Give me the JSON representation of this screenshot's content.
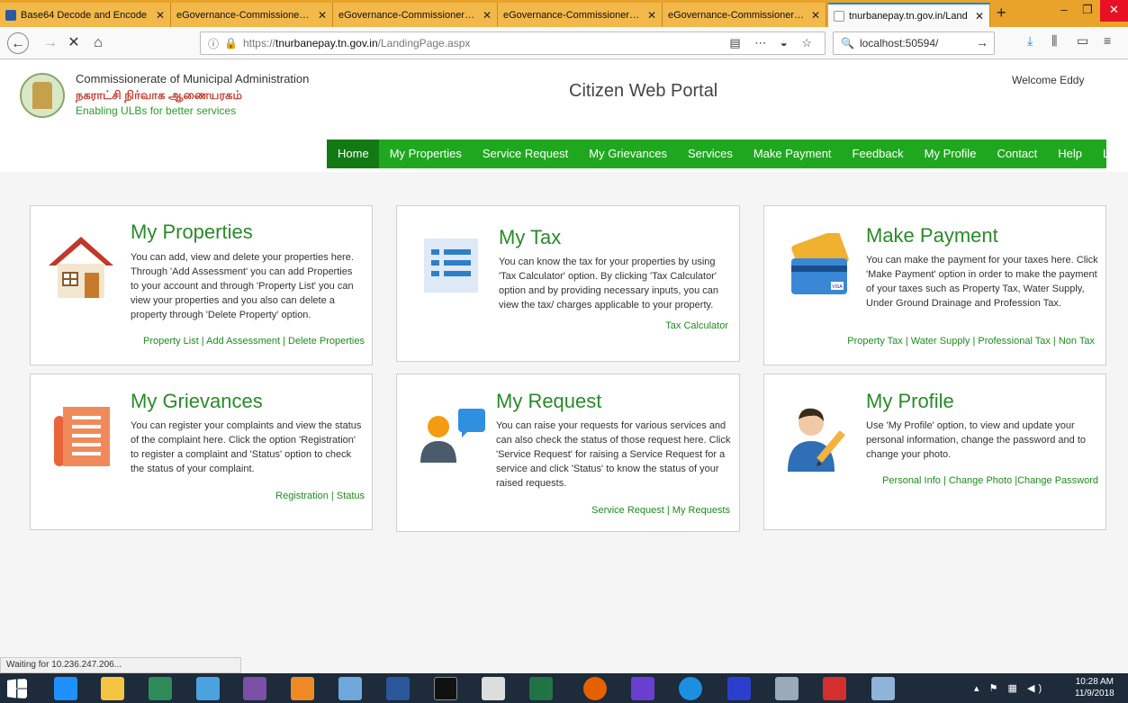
{
  "browser": {
    "tabs": [
      {
        "label": "Base64 Decode and Encode",
        "active": false
      },
      {
        "label": "eGovernance-Commissionerate",
        "active": false
      },
      {
        "label": "eGovernance-Commissionerate",
        "active": false
      },
      {
        "label": "eGovernance-Commissionerate",
        "active": false
      },
      {
        "label": "eGovernance-Commissionerate",
        "active": false
      },
      {
        "label": "tnurbanepay.tn.gov.in/Land",
        "active": true
      }
    ],
    "url_prefix": "https://",
    "url_host": "tnurbanepay.tn.gov.in",
    "url_path": "/LandingPage.aspx",
    "search_value": "localhost:50594/",
    "status_text": "Waiting for 10.236.247.206..."
  },
  "header": {
    "org_line1": "Commissionerate of Municipal Administration",
    "org_line2": "நகராட்சி நிர்வாக ஆணையரகம்",
    "org_line3": "Enabling ULBs for better services",
    "portal_title": "Citizen Web Portal",
    "welcome": "Welcome Eddy"
  },
  "menu": {
    "items": [
      "Home",
      "My Properties",
      "Service Request",
      "My Grievances",
      "Services",
      "Make Payment",
      "Feedback",
      "My Profile",
      "Contact",
      "Help",
      "Logout"
    ],
    "active_index": 0
  },
  "cards": {
    "properties": {
      "title": "My Properties",
      "text": "You can add, view and delete your properties here. Through 'Add Assessment' you can add Properties to your account and through 'Property List' you can view your properties and you also can delete a property through 'Delete Property' option.",
      "links": "Property List | Add Assessment | Delete Properties"
    },
    "tax": {
      "title": "My Tax",
      "text": "You can know the tax for your properties by using 'Tax Calculator' option. By clicking 'Tax Calculator' option and by providing necessary inputs, you can view the tax/ charges applicable to your property.",
      "links": "Tax Calculator"
    },
    "payment": {
      "title": "Make Payment",
      "text": "You can make the payment for your taxes here. Click 'Make Payment' option in order to make the payment of your taxes such as Property Tax, Water Supply, Under Ground Drainage and Profession Tax.",
      "links": "Property Tax | Water Supply | Professional Tax | Non Tax",
      "card_logo": "VISA"
    },
    "grievances": {
      "title": "My Grievances",
      "text": "You can register your complaints and view the status of the complaint here. Click the option 'Registration' to register a complaint and 'Status' option to check the status of your complaint.",
      "links": "Registration | Status"
    },
    "request": {
      "title": "My Request",
      "text": "You can raise your requests for various services and can also check the status of those request here. Click 'Service Request' for raising a Service Request for a service and click 'Status' to know the status of your raised requests.",
      "links": "Service Request | My Requests"
    },
    "profile": {
      "title": "My Profile",
      "text": "Use 'My Profile' option, to view and update your personal information, change the password and to change your photo.",
      "links": "Personal Info | Change Photo |Change Password"
    }
  },
  "taskbar": {
    "time": "10:28 AM",
    "date": "11/9/2018"
  },
  "colors": {
    "menu_green": "#1fa81f",
    "menu_active": "#137a13",
    "title_green": "#2a8a2a",
    "tab_orange": "#e9a32a"
  }
}
